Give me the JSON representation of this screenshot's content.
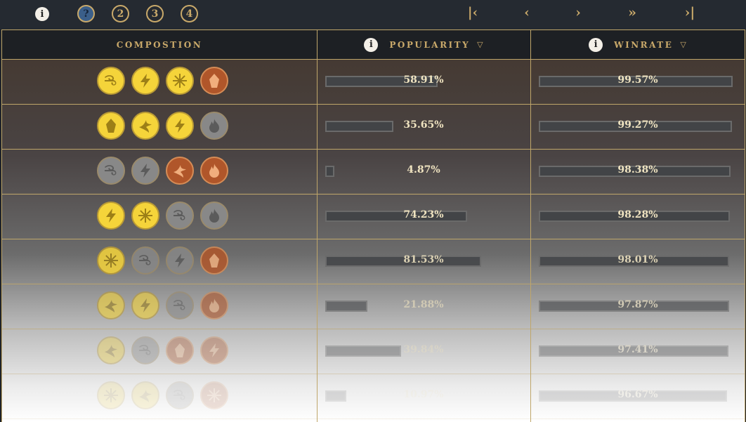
{
  "topbar": {
    "info_icon": "i",
    "steps": [
      {
        "label": "?",
        "active": true
      },
      {
        "label": "2",
        "active": false
      },
      {
        "label": "3",
        "active": false
      },
      {
        "label": "4",
        "active": false
      }
    ],
    "pager": {
      "first": "|‹",
      "prev": "‹",
      "next": "›",
      "fast_forward": "»",
      "last": "›|"
    }
  },
  "headers": {
    "composition": "COMPOSTION",
    "popularity": "POPULARITY",
    "winrate": "WINRATE",
    "info_icon": "i",
    "sort_icon": "▽"
  },
  "rows": [
    {
      "elements": [
        "wind",
        "lightning",
        "ice",
        "earth"
      ],
      "colors": [
        "yellow",
        "yellow",
        "yellow",
        "brown"
      ],
      "popularity": "58.91%",
      "popularity_value": 58.91,
      "winrate": "99.57%",
      "winrate_value": 99.57
    },
    {
      "elements": [
        "earth",
        "bird",
        "lightning",
        "fire"
      ],
      "colors": [
        "yellow",
        "yellow",
        "yellow",
        "gray"
      ],
      "popularity": "35.65%",
      "popularity_value": 35.65,
      "winrate": "99.27%",
      "winrate_value": 99.27
    },
    {
      "elements": [
        "wind",
        "lightning",
        "bird",
        "fire"
      ],
      "colors": [
        "gray",
        "gray",
        "brown",
        "brown"
      ],
      "popularity": "4.87%",
      "popularity_value": 4.87,
      "winrate": "98.38%",
      "winrate_value": 98.38
    },
    {
      "elements": [
        "lightning",
        "ice",
        "wind",
        "fire"
      ],
      "colors": [
        "yellow",
        "yellow",
        "gray",
        "gray"
      ],
      "popularity": "74.23%",
      "popularity_value": 74.23,
      "winrate": "98.28%",
      "winrate_value": 98.28
    },
    {
      "elements": [
        "ice",
        "wind",
        "lightning",
        "earth"
      ],
      "colors": [
        "yellow",
        "gray",
        "gray",
        "brown"
      ],
      "popularity": "81.53%",
      "popularity_value": 81.53,
      "winrate": "98.01%",
      "winrate_value": 98.01
    },
    {
      "elements": [
        "bird",
        "lightning",
        "wind",
        "fire"
      ],
      "colors": [
        "yellow",
        "yellow",
        "gray",
        "brown"
      ],
      "popularity": "21.88%",
      "popularity_value": 21.88,
      "winrate": "97.87%",
      "winrate_value": 97.87
    },
    {
      "elements": [
        "bird",
        "wind",
        "earth",
        "lightning"
      ],
      "colors": [
        "yellow",
        "gray",
        "brown",
        "brown"
      ],
      "popularity": "39.84%",
      "popularity_value": 39.84,
      "winrate": "97.41%",
      "winrate_value": 97.41
    },
    {
      "elements": [
        "ice",
        "bird",
        "wind",
        "ice"
      ],
      "colors": [
        "yellow",
        "yellow",
        "gray",
        "brown"
      ],
      "popularity": "10.97%",
      "popularity_value": 10.97,
      "winrate": "96.67%",
      "winrate_value": 96.67
    }
  ]
}
